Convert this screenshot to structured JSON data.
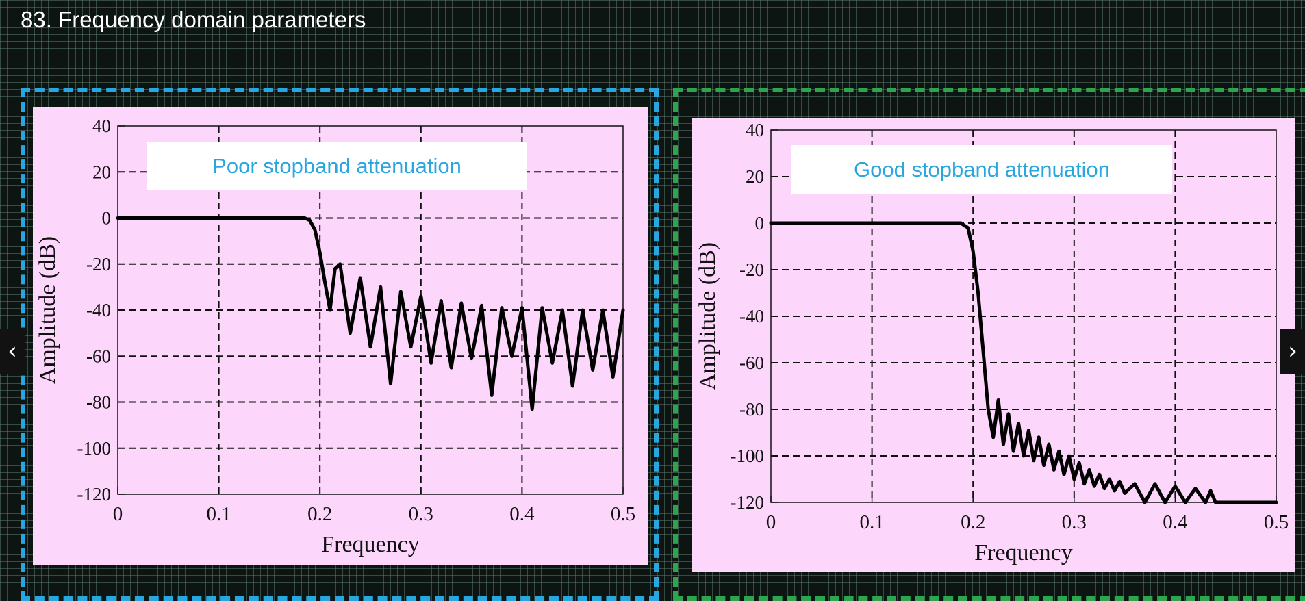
{
  "slide": {
    "title": "83. Frequency domain parameters"
  },
  "navigation": {
    "prev_icon": "‹",
    "next_icon": "›"
  },
  "colors": {
    "left_frame": "#27a6df",
    "right_frame": "#2da44e",
    "panel_bg": "#fdd7fb",
    "title_text": "#2aa6df"
  },
  "chart_data": [
    {
      "type": "line",
      "title": "Poor stopband attenuation",
      "xlabel": "Frequency",
      "ylabel": "Amplitude (dB)",
      "xlim": [
        0,
        0.5
      ],
      "ylim": [
        -120,
        40
      ],
      "xticks": [
        0,
        0.1,
        0.2,
        0.3,
        0.4,
        0.5
      ],
      "xtick_labels": [
        "0",
        "0.1",
        "0.2",
        "0.3",
        "0.4",
        "0.5"
      ],
      "yticks": [
        40,
        20,
        0,
        -20,
        -40,
        -60,
        -80,
        -100,
        -120
      ],
      "ytick_labels": [
        "40",
        "20",
        "0",
        "-20",
        "-40",
        "-60",
        "-80",
        "-100",
        "-120"
      ],
      "grid": true,
      "series": [
        {
          "x": [
            0,
            0.185,
            0.19,
            0.195,
            0.2,
            0.205,
            0.21,
            0.215,
            0.22,
            0.23,
            0.24,
            0.25,
            0.26,
            0.27,
            0.28,
            0.29,
            0.3,
            0.31,
            0.32,
            0.33,
            0.34,
            0.35,
            0.36,
            0.37,
            0.38,
            0.39,
            0.4,
            0.41,
            0.42,
            0.43,
            0.44,
            0.45,
            0.46,
            0.47,
            0.48,
            0.49,
            0.5
          ],
          "y": [
            0,
            0,
            -1,
            -5,
            -15,
            -28,
            -40,
            -22,
            -20,
            -50,
            -26,
            -56,
            -30,
            -72,
            -32,
            -56,
            -34,
            -63,
            -36,
            -65,
            -37,
            -61,
            -38,
            -77,
            -39,
            -60,
            -39,
            -83,
            -39,
            -63,
            -40,
            -73,
            -40,
            -66,
            -40,
            -69,
            -40
          ]
        }
      ]
    },
    {
      "type": "line",
      "title": "Good stopband attenuation",
      "xlabel": "Frequency",
      "ylabel": "Amplitude (dB)",
      "xlim": [
        0,
        0.5
      ],
      "ylim": [
        -120,
        40
      ],
      "xticks": [
        0,
        0.1,
        0.2,
        0.3,
        0.4,
        0.5
      ],
      "xtick_labels": [
        "0",
        "0.1",
        "0.2",
        "0.3",
        "0.4",
        "0.5"
      ],
      "yticks": [
        40,
        20,
        0,
        -20,
        -40,
        -60,
        -80,
        -100,
        -120
      ],
      "ytick_labels": [
        "40",
        "20",
        "0",
        "-20",
        "-40",
        "-60",
        "-80",
        "-100",
        "-120"
      ],
      "grid": true,
      "series": [
        {
          "x": [
            0,
            0.188,
            0.195,
            0.2,
            0.205,
            0.21,
            0.215,
            0.22,
            0.225,
            0.23,
            0.235,
            0.24,
            0.245,
            0.25,
            0.255,
            0.26,
            0.265,
            0.27,
            0.275,
            0.28,
            0.285,
            0.29,
            0.295,
            0.3,
            0.305,
            0.31,
            0.315,
            0.32,
            0.325,
            0.33,
            0.335,
            0.34,
            0.345,
            0.35,
            0.36,
            0.37,
            0.38,
            0.39,
            0.4,
            0.41,
            0.42,
            0.43,
            0.435,
            0.44,
            0.5
          ],
          "y": [
            0,
            0,
            -2,
            -12,
            -30,
            -55,
            -80,
            -92,
            -76,
            -95,
            -82,
            -98,
            -86,
            -100,
            -89,
            -102,
            -92,
            -104,
            -95,
            -106,
            -98,
            -108,
            -100,
            -110,
            -103,
            -112,
            -106,
            -113,
            -108,
            -114,
            -110,
            -115,
            -111,
            -116,
            -112,
            -120,
            -112,
            -120,
            -113,
            -120,
            -114,
            -120,
            -115,
            -120,
            -120
          ]
        }
      ]
    }
  ]
}
